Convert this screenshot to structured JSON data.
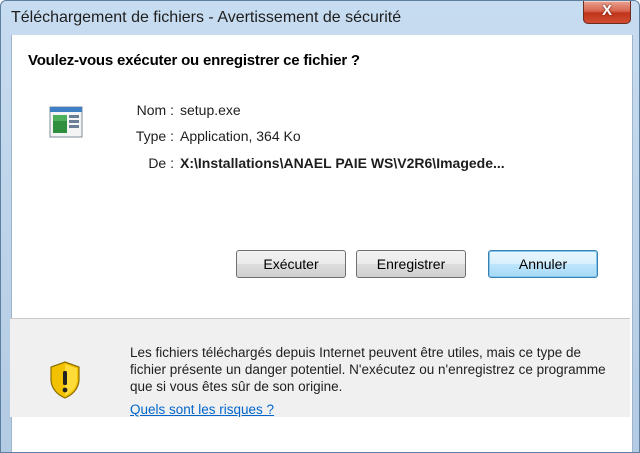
{
  "window": {
    "title": "Téléchargement de fichiers - Avertissement de sécurité",
    "close_glyph": "X"
  },
  "dialog": {
    "question": "Voulez-vous exécuter ou enregistrer ce fichier ?",
    "file_icon": "application-file-icon",
    "fields": {
      "name_label": "Nom :",
      "name_value": "setup.exe",
      "type_label": "Type :",
      "type_value": "Application, 364 Ko",
      "from_label": "De :",
      "from_value": "X:\\Installations\\ANAEL PAIE WS\\V2R6\\Imagede..."
    },
    "buttons": {
      "run": "Exécuter",
      "save": "Enregistrer",
      "cancel": "Annuler"
    }
  },
  "warning": {
    "icon": "shield-warning-icon",
    "text": "Les fichiers téléchargés depuis Internet peuvent être utiles, mais ce type de fichier présente un danger potentiel. N'exécutez ou n'enregistrez ce programme que si vous êtes sûr de son origine.",
    "link": "Quels sont les risques ?"
  },
  "colors": {
    "link": "#0066cc",
    "close_button": "#c1351c",
    "shield_yellow": "#f2c200"
  }
}
